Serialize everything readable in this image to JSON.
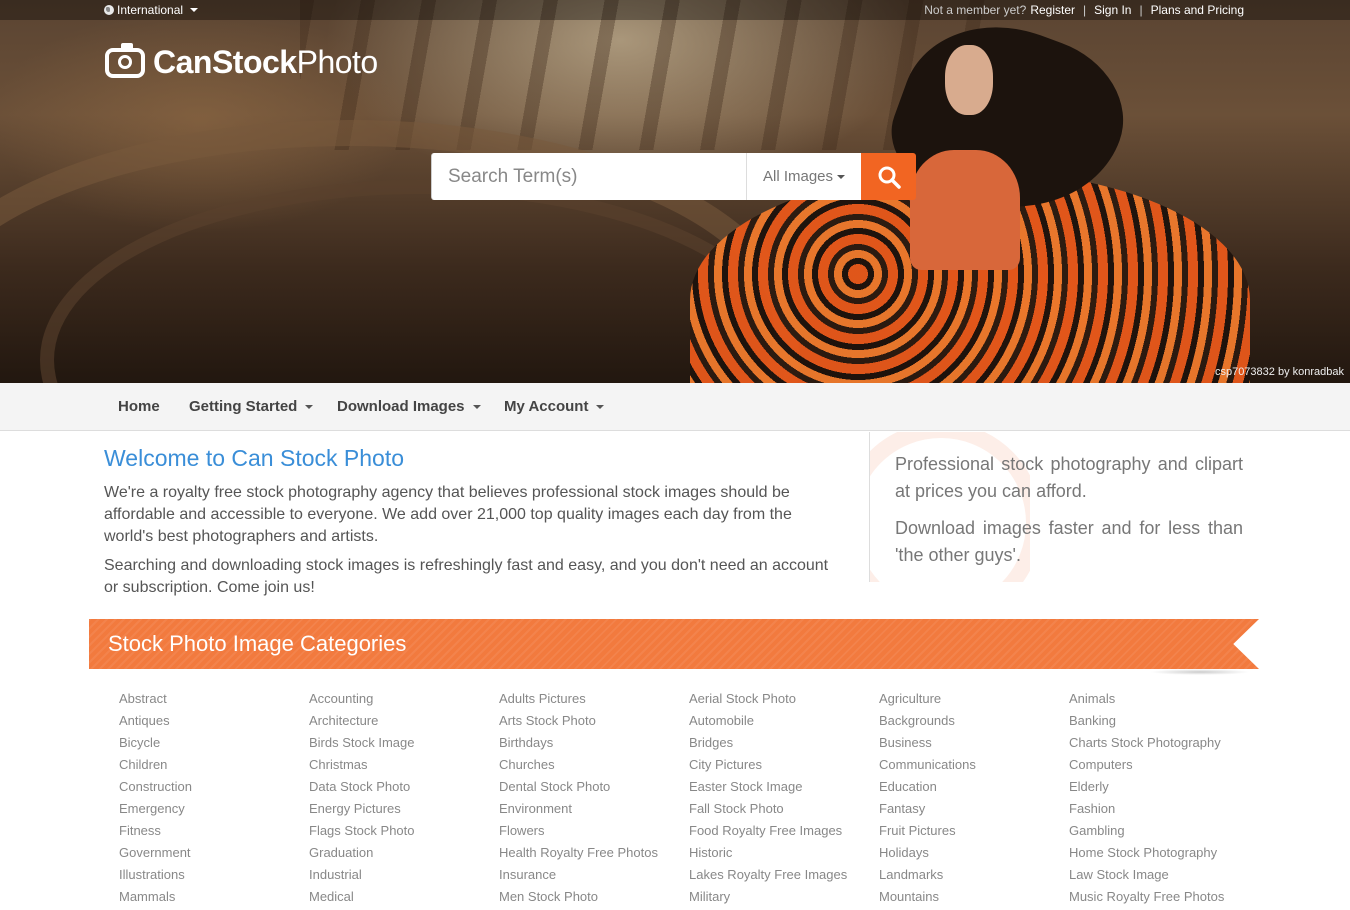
{
  "topbar": {
    "international": "International",
    "not_member": "Not a member yet?",
    "register": "Register",
    "sign_in": "Sign In",
    "plans": "Plans and Pricing"
  },
  "logo": {
    "can_stock": "CanStock",
    "photo": "Photo"
  },
  "search": {
    "placeholder": "Search Term(s)",
    "filter_value": "All Images",
    "button_icon": "search-icon"
  },
  "hero": {
    "credit": "csp7073832 by konradbak"
  },
  "nav": {
    "items": [
      {
        "label": "Home"
      },
      {
        "label": "Getting Started"
      },
      {
        "label": "Download Images"
      },
      {
        "label": "My Account"
      }
    ]
  },
  "welcome": {
    "title": "Welcome to Can Stock Photo",
    "p1": "We're a royalty free stock photography agency that believes professional stock images should be affordable and accessible to everyone. We add over 21,000 top quality images each day from the world's best photographers and artists.",
    "p2": "Searching and downloading stock images is refreshingly fast and easy, and you don't need an account or subscription. Come join us!"
  },
  "sidebar": {
    "p1": "Professional stock photography and clipart at prices you can afford.",
    "p2": "Download images faster and for less than 'the other guys'."
  },
  "categories": {
    "title": "Stock Photo Image Categories",
    "items": [
      "Abstract",
      "Accounting",
      "Adults Pictures",
      "Aerial Stock Photo",
      "Agriculture",
      "Animals",
      "Antiques",
      "Architecture",
      "Arts Stock Photo",
      "Automobile",
      "Backgrounds",
      "Banking",
      "Bicycle",
      "Birds Stock Image",
      "Birthdays",
      "Bridges",
      "Business",
      "Charts Stock Photography",
      "Children",
      "Christmas",
      "Churches",
      "City Pictures",
      "Communications",
      "Computers",
      "Construction",
      "Data Stock Photo",
      "Dental Stock Photo",
      "Easter Stock Image",
      "Education",
      "Elderly",
      "Emergency",
      "Energy Pictures",
      "Environment",
      "Fall Stock Photo",
      "Fantasy",
      "Fashion",
      "Fitness",
      "Flags Stock Photo",
      "Flowers",
      "Food Royalty Free Images",
      "Fruit Pictures",
      "Gambling",
      "Government",
      "Graduation",
      "Health Royalty Free Photos",
      "Historic",
      "Holidays",
      "Home Stock Photography",
      "Illustrations",
      "Industrial",
      "Insurance",
      "Lakes Royalty Free Images",
      "Landmarks",
      "Law Stock Image",
      "Mammals",
      "Medical",
      "Men Stock Photo",
      "Military",
      "Mountains",
      "Music Royalty Free Photos"
    ]
  },
  "colors": {
    "accent": "#f26522",
    "link_blue": "#3a8ed8"
  }
}
